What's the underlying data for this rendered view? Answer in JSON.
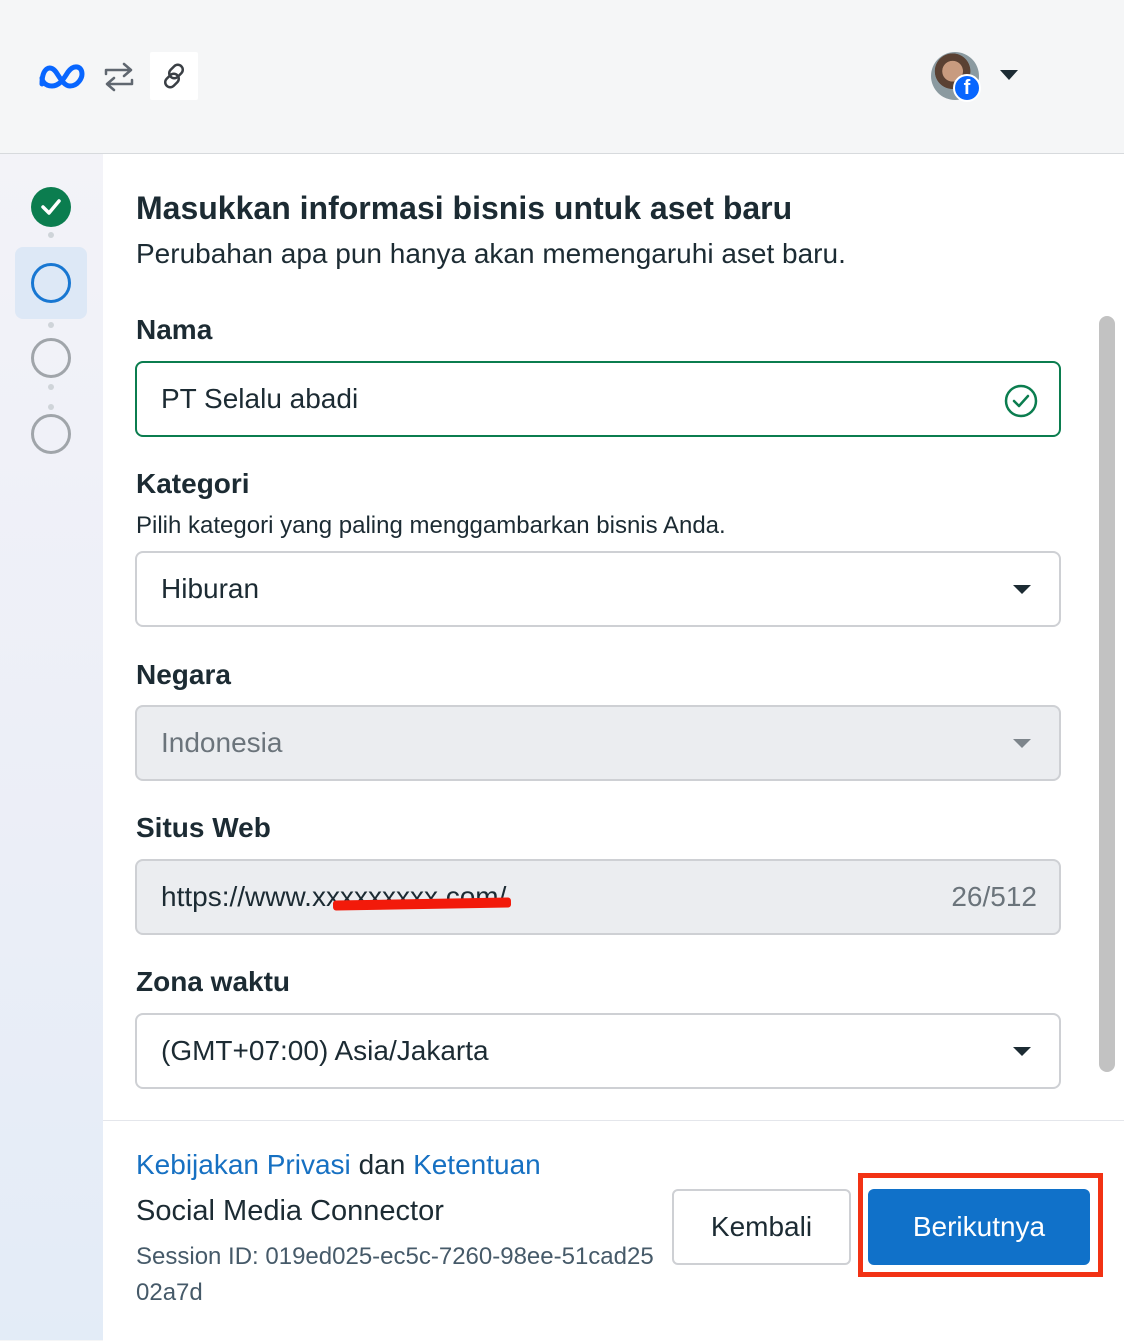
{
  "header": {
    "logo_icon": "meta-logo",
    "sync_icon": "sync-icon",
    "link_icon": "link-icon",
    "avatar_badge_text": "f"
  },
  "stepper": {
    "steps": [
      "done",
      "current",
      "todo",
      "todo"
    ]
  },
  "form": {
    "title": "Masukkan informasi bisnis untuk aset baru",
    "subtitle": "Perubahan apa pun hanya akan memengaruhi aset baru.",
    "name": {
      "label": "Nama",
      "value": "PT Selalu abadi"
    },
    "category": {
      "label": "Kategori",
      "helper": "Pilih kategori yang paling menggambarkan bisnis Anda.",
      "value": "Hiburan"
    },
    "country": {
      "label": "Negara",
      "value": "Indonesia"
    },
    "website": {
      "label": "Situs Web",
      "value": "https://www.xxxxxxxxx.com/",
      "counter": "26/512"
    },
    "timezone": {
      "label": "Zona waktu",
      "value": "(GMT+07:00) Asia/Jakarta"
    }
  },
  "footer": {
    "privacy_link": "Kebijakan Privasi",
    "and_text": "dan",
    "terms_link": "Ketentuan",
    "app_name": "Social Media Connector",
    "session_id": "Session ID: 019ed025-ec5c-7260-98ee-51cad2502a7d",
    "back_label": "Kembali",
    "next_label": "Berikutnya"
  },
  "colors": {
    "primary": "#1071c9",
    "success": "#0b7d4f",
    "link": "#1670c2",
    "highlight": "#f23214"
  }
}
